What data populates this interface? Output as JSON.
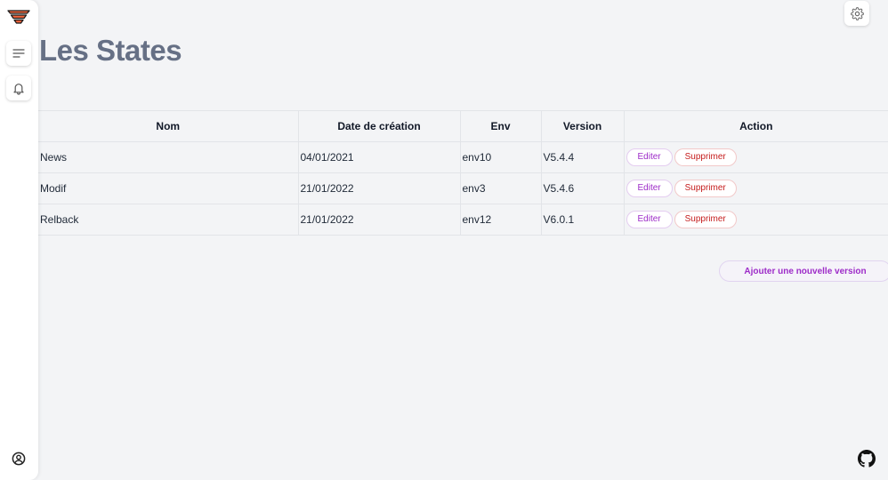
{
  "app": {
    "icons": {
      "logo": "layered-logo-icon",
      "menu": "menu-lines-icon",
      "notifications": "bell-icon",
      "user": "user-circle-icon",
      "settings": "gear-icon",
      "github": "github-icon"
    },
    "colors": {
      "logo_orange": "#f0643c",
      "logo_outline": "#1a1a1a",
      "title": "#667085",
      "edit": "#9d2bc8",
      "delete": "#c51c1c"
    }
  },
  "page": {
    "title": "Les States"
  },
  "table": {
    "columns": [
      "Nom",
      "Date de création",
      "Env",
      "Version",
      "Action"
    ],
    "rows": [
      {
        "nom": "News",
        "date": "04/01/2021",
        "env": "env10",
        "version": "V5.4.4"
      },
      {
        "nom": "Modif",
        "date": "21/01/2022",
        "env": "env3",
        "version": "V5.4.6"
      },
      {
        "nom": "Relback",
        "date": "21/01/2022",
        "env": "env12",
        "version": "V6.0.1"
      }
    ],
    "actions": {
      "edit_label": "Editer",
      "delete_label": "Supprimer"
    }
  },
  "add_button": {
    "label": "Ajouter une nouvelle version"
  }
}
